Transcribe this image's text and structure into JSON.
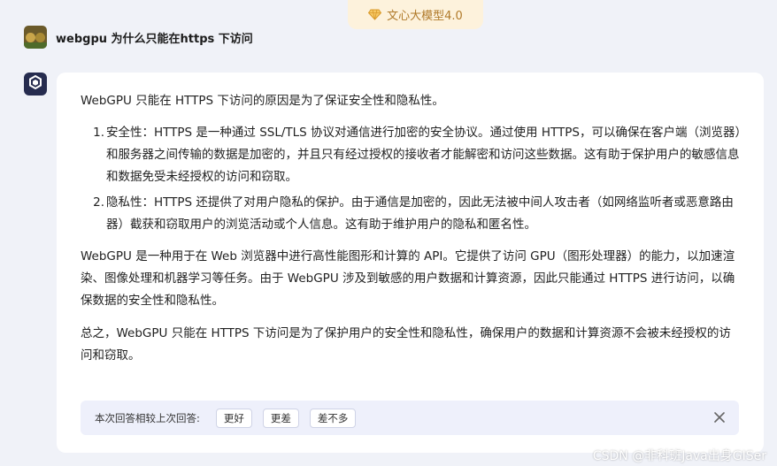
{
  "model_badge": {
    "label": "文心大模型4.0",
    "icon": "diamond-icon",
    "color": "#b07a2a"
  },
  "user": {
    "avatar": "user-avatar-image",
    "question": "webgpu 为什么只能在https 下访问"
  },
  "bot": {
    "avatar": "ernie-bot-logo-icon"
  },
  "answer": {
    "intro": "WebGPU 只能在 HTTPS 下访问的原因是为了保证安全性和隐私性。",
    "list": [
      {
        "num": "1.",
        "text": "安全性：HTTPS 是一种通过 SSL/TLS 协议对通信进行加密的安全协议。通过使用 HTTPS，可以确保在客户端（浏览器）和服务器之间传输的数据是加密的，并且只有经过授权的接收者才能解密和访问这些数据。这有助于保护用户的敏感信息和数据免受未经授权的访问和窃取。"
      },
      {
        "num": "2.",
        "text": "隐私性：HTTPS 还提供了对用户隐私的保护。由于通信是加密的，因此无法被中间人攻击者（如网络监听者或恶意路由器）截获和窃取用户的浏览活动或个人信息。这有助于维护用户的隐私和匿名性。"
      }
    ],
    "para2": "WebGPU 是一种用于在 Web 浏览器中进行高性能图形和计算的 API。它提供了访问 GPU（图形处理器）的能力，以加速渲染、图像处理和机器学习等任务。由于 WebGPU 涉及到敏感的用户数据和计算资源，因此只能通过 HTTPS 进行访问，以确保数据的安全性和隐私性。",
    "para3": "总之，WebGPU 只能在 HTTPS 下访问是为了保护用户的安全性和隐私性，确保用户的数据和计算资源不会被未经授权的访问和窃取。"
  },
  "feedback": {
    "label": "本次回答相较上次回答:",
    "better": "更好",
    "worse": "更差",
    "same": "差不多",
    "close_icon": "close-icon"
  },
  "watermark": "CSDN @非科班Java出身GISer"
}
